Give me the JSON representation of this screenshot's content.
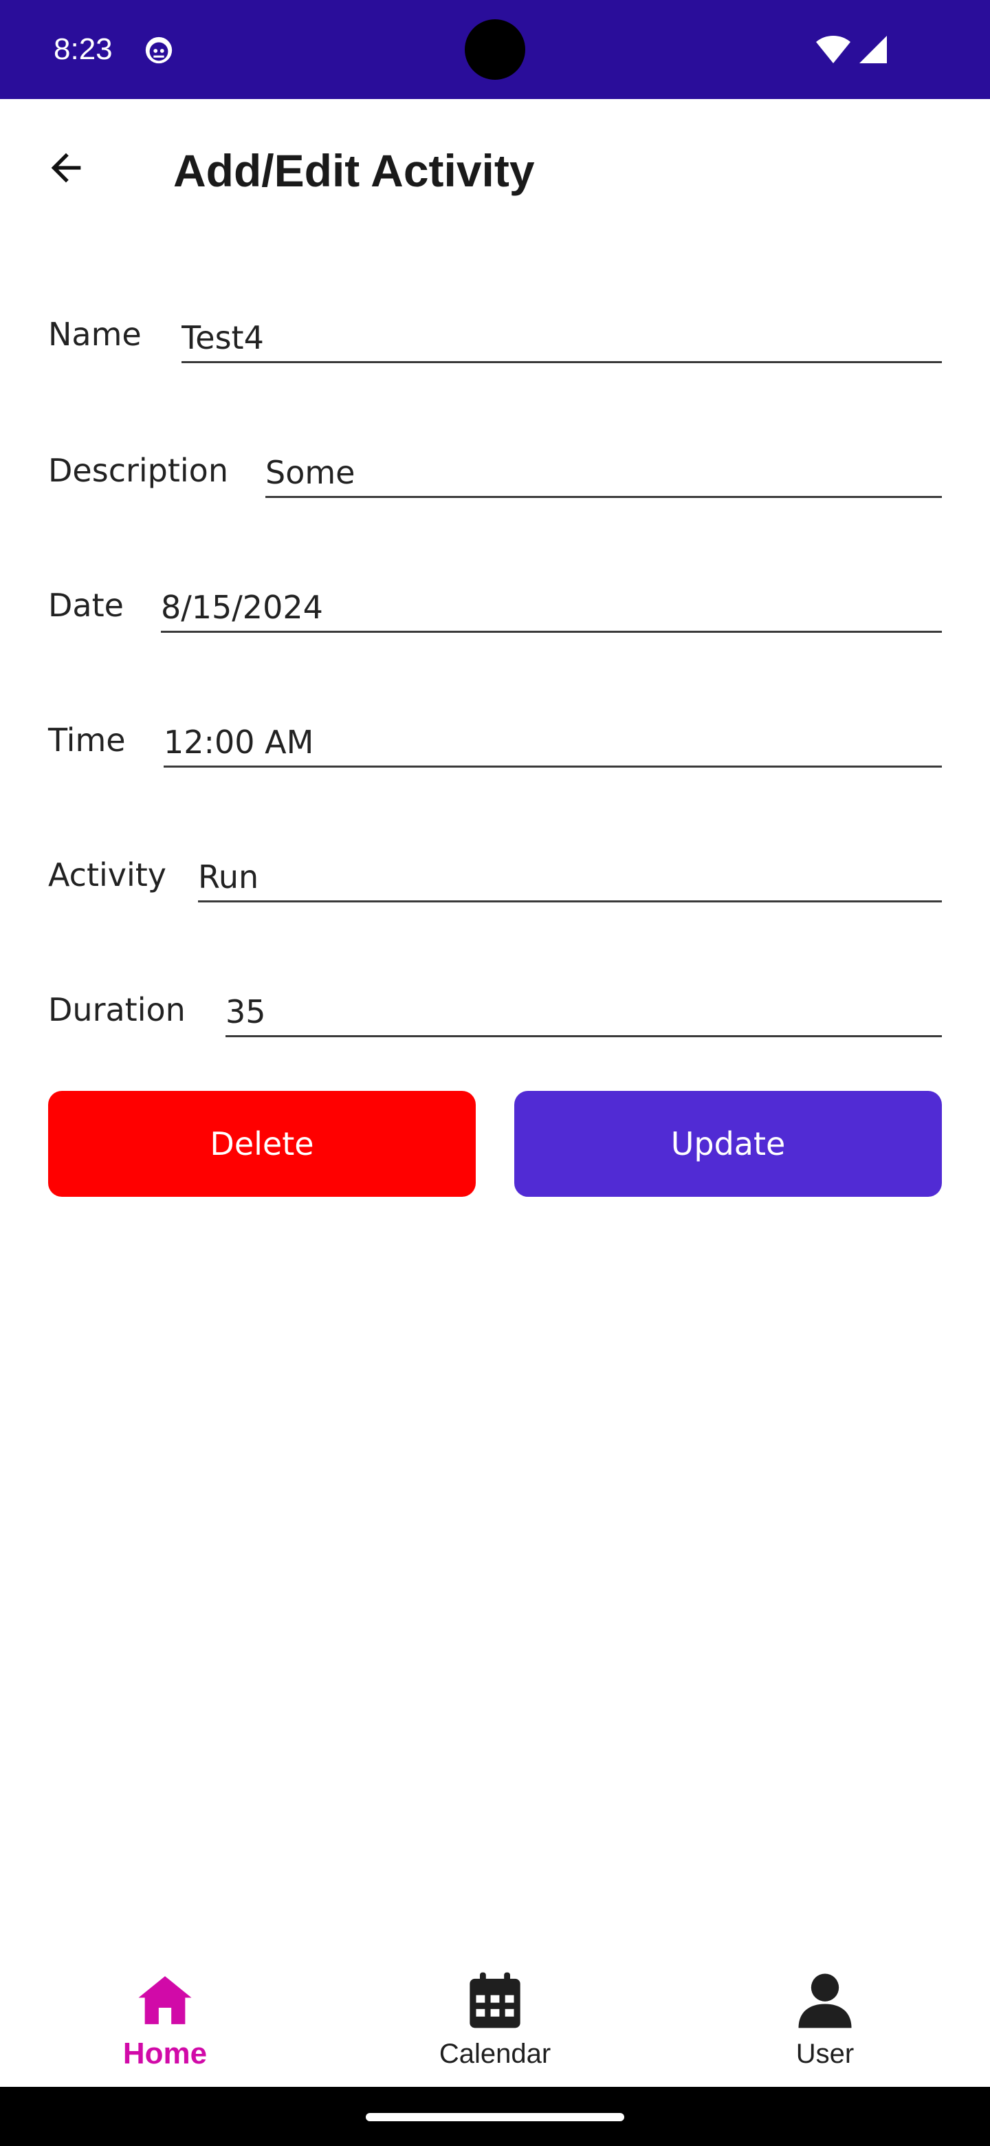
{
  "status_bar": {
    "time": "8:23",
    "background": "#2a0d9a"
  },
  "header": {
    "title": "Add/Edit Activity"
  },
  "form": {
    "name": {
      "label": "Name",
      "value": "Test4"
    },
    "description": {
      "label": "Description",
      "value": "Some"
    },
    "date": {
      "label": "Date",
      "value": "8/15/2024"
    },
    "time": {
      "label": "Time",
      "value": "12:00 AM"
    },
    "activity": {
      "label": "Activity",
      "value": "Run"
    },
    "duration": {
      "label": "Duration",
      "value": "35"
    }
  },
  "actions": {
    "delete_label": "Delete",
    "delete_color": "#ff0000",
    "update_label": "Update",
    "update_color": "#512bd4"
  },
  "bottom_nav": {
    "active_color": "#d10aa8",
    "inactive_color": "#1f1f1f",
    "items": [
      {
        "label": "Home",
        "icon": "home-icon",
        "active": true
      },
      {
        "label": "Calendar",
        "icon": "calendar-icon",
        "active": false
      },
      {
        "label": "User",
        "icon": "user-icon",
        "active": false
      }
    ]
  }
}
